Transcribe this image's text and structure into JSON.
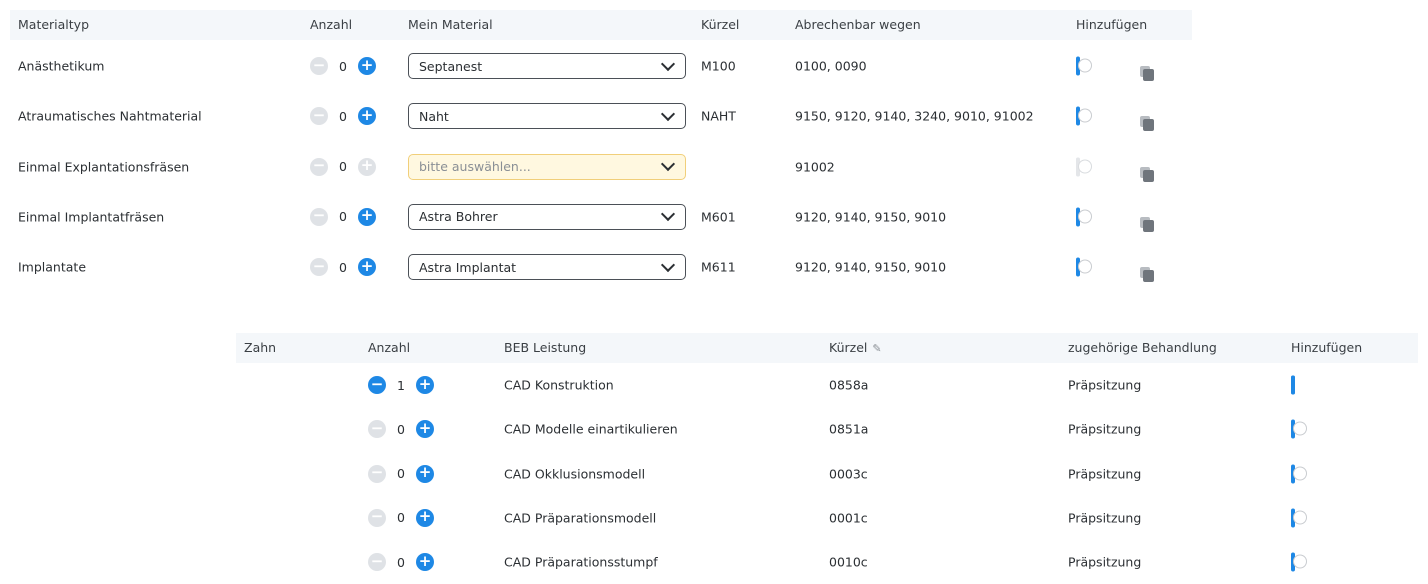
{
  "materials": {
    "headers": {
      "materialtyp": "Materialtyp",
      "anzahl": "Anzahl",
      "mein_material": "Mein Material",
      "kuerzel": "Kürzel",
      "abrechenbar": "Abrechenbar wegen",
      "hinzufuegen": "Hinzufügen"
    },
    "rows": [
      {
        "type": "Anästhetikum",
        "count": "0",
        "material": "Septanest",
        "kuerzel": "M100",
        "abrechenbar": "0100, 0090",
        "toggle": "off",
        "plus_enabled": true,
        "placeholder": false
      },
      {
        "type": "Atraumatisches Nahtmaterial",
        "count": "0",
        "material": "Naht",
        "kuerzel": "NAHT",
        "abrechenbar": "9150, 9120, 9140, 3240, 9010, 91002",
        "toggle": "off",
        "plus_enabled": true,
        "placeholder": false
      },
      {
        "type": "Einmal Explantationsfräsen",
        "count": "0",
        "material": "bitte auswählen...",
        "kuerzel": "",
        "abrechenbar": "91002",
        "toggle": "disabled",
        "plus_enabled": false,
        "placeholder": true
      },
      {
        "type": "Einmal Implantatfräsen",
        "count": "0",
        "material": "Astra Bohrer",
        "kuerzel": "M601",
        "abrechenbar": "9120, 9140, 9150, 9010",
        "toggle": "off",
        "plus_enabled": true,
        "placeholder": false
      },
      {
        "type": "Implantate",
        "count": "0",
        "material": "Astra Implantat",
        "kuerzel": "M611",
        "abrechenbar": "9120, 9140, 9150, 9010",
        "toggle": "off",
        "plus_enabled": true,
        "placeholder": false
      }
    ]
  },
  "beb": {
    "headers": {
      "zahn": "Zahn",
      "anzahl": "Anzahl",
      "leistung": "BEB Leistung",
      "kuerzel": "Kürzel",
      "behandlung": "zugehörige Behandlung",
      "hinzufuegen": "Hinzufügen"
    },
    "rows": [
      {
        "zahn": "",
        "count": "1",
        "leistung": "CAD Konstruktion",
        "kuerzel": "0858a",
        "behandlung": "Präpsitzung",
        "toggle": "on",
        "minus_enabled": true
      },
      {
        "zahn": "",
        "count": "0",
        "leistung": "CAD Modelle einartikulieren",
        "kuerzel": "0851a",
        "behandlung": "Präpsitzung",
        "toggle": "off",
        "minus_enabled": false
      },
      {
        "zahn": "",
        "count": "0",
        "leistung": "CAD Okklusionsmodell",
        "kuerzel": "0003c",
        "behandlung": "Präpsitzung",
        "toggle": "off",
        "minus_enabled": false
      },
      {
        "zahn": "",
        "count": "0",
        "leistung": "CAD Präparationsmodell",
        "kuerzel": "0001c",
        "behandlung": "Präpsitzung",
        "toggle": "off",
        "minus_enabled": false
      },
      {
        "zahn": "",
        "count": "0",
        "leistung": "CAD Präparationsstumpf",
        "kuerzel": "0010c",
        "behandlung": "Präpsitzung",
        "toggle": "off",
        "minus_enabled": false
      }
    ]
  },
  "colors": {
    "accent": "#1e88e5",
    "header_bg": "#f4f7fa",
    "placeholder_bg": "#fff8e0"
  },
  "icons": {
    "minus": "minus-circle-icon",
    "plus": "plus-circle-icon",
    "copy": "copy-icon",
    "edit": "pencil-icon",
    "dropdown": "chevron-down-icon"
  }
}
